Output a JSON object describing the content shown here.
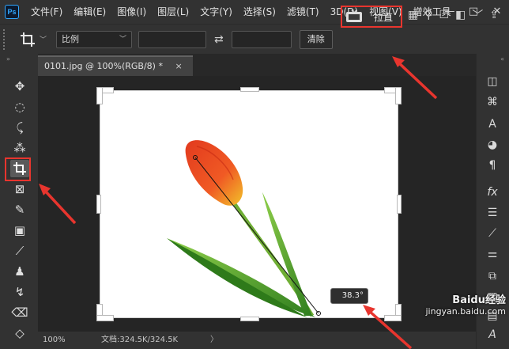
{
  "app": {
    "logo": "Ps"
  },
  "menu": [
    "文件(F)",
    "编辑(E)",
    "图像(I)",
    "图层(L)",
    "文字(Y)",
    "选择(S)",
    "滤镜(T)",
    "3D(D)",
    "视图(V)",
    "增效工具"
  ],
  "window_controls": {
    "minimize": "—",
    "maximize": "□",
    "close": "✕"
  },
  "options": {
    "ratio_label": "比例",
    "swap_icon": "swap-icon",
    "clear_label": "清除",
    "straighten_label": "拉直"
  },
  "document": {
    "tab_title": "0101.jpg @ 100%(RGB/8) *",
    "close_glyph": "×"
  },
  "status": {
    "zoom": "100%",
    "doc_size": "文档:324.5K/324.5K",
    "arrow": "〉"
  },
  "canvas": {
    "angle": "38.3°",
    "background": "#ffffff"
  },
  "watermark": {
    "line1": "Baidu经验",
    "line2": "jingyan.baidu.com"
  },
  "colors": {
    "accent_red": "#e8352e",
    "ui_dark": "#323232",
    "canvas_bg": "#252525"
  }
}
